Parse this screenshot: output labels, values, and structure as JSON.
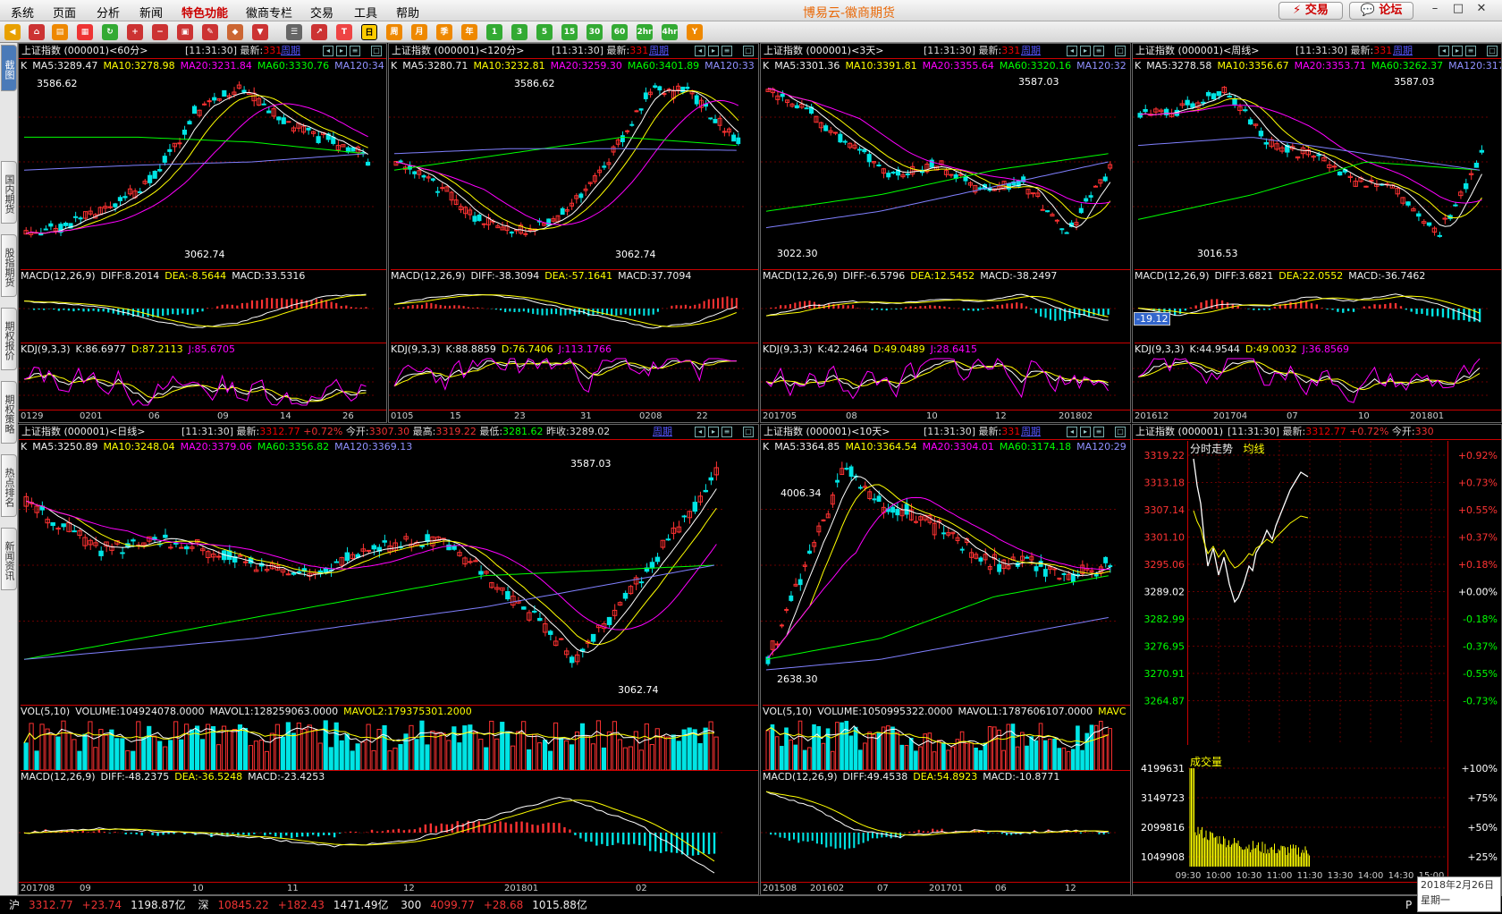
{
  "menu": [
    "系统",
    "页面",
    "分析",
    "新闻",
    "特色功能",
    "徽商专栏",
    "交易",
    "工具",
    "帮助"
  ],
  "app_title": "博易云-徽商期货",
  "buttons": {
    "trade": "交易",
    "forum": "论坛"
  },
  "toolbar_periods": [
    "周",
    "月",
    "季",
    "年",
    "1",
    "3",
    "5",
    "15",
    "30",
    "60",
    "2hr",
    "4hr",
    "Y"
  ],
  "sidebar_tabs": [
    "截图",
    "国内期货",
    "股指期货",
    "期权报价",
    "期权策略",
    "热点排名",
    "新闻资讯"
  ],
  "colors": {
    "up": "#ff3232",
    "down": "#00e5e5",
    "ma5": "#ffffff",
    "ma10": "#ffff00",
    "ma20": "#ff00ff",
    "ma60": "#00ff00",
    "ma120": "#8080ff"
  },
  "common": {
    "name": "上证指数 (000001)",
    "time": "[11:31:30]",
    "last_label": "最新:",
    "last": "331",
    "zq": "周期",
    "k": "K"
  },
  "p1": {
    "period": "<60分>",
    "ma": [
      "MA5:3289.47",
      "MA10:3278.98",
      "MA20:3231.84",
      "MA60:3330.76",
      "MA120:34"
    ],
    "hi": "3586.62",
    "lo": "3062.74",
    "macd": [
      "MACD(12,26,9)",
      "DIFF:8.2014",
      "DEA:-8.5644",
      "MACD:33.5316"
    ],
    "kdj": [
      "KDJ(9,3,3)",
      "K:86.6977",
      "D:87.2113",
      "J:85.6705"
    ],
    "x": [
      "0129",
      "0201",
      "06",
      "09",
      "14",
      "26"
    ]
  },
  "p2": {
    "period": "<120分>",
    "ma": [
      "MA5:3280.71",
      "MA10:3232.81",
      "MA20:3259.30",
      "MA60:3401.89",
      "MA120:33"
    ],
    "hi": "3586.62",
    "lo": "3062.74",
    "macd": [
      "MACD(12,26,9)",
      "DIFF:-38.3094",
      "DEA:-57.1641",
      "MACD:37.7094"
    ],
    "kdj": [
      "KDJ(9,3,3)",
      "K:88.8859",
      "D:76.7406",
      "J:113.1766"
    ],
    "x": [
      "0105",
      "15",
      "23",
      "31",
      "0208",
      "22"
    ]
  },
  "p3": {
    "period": "<3天>",
    "ma": [
      "MA5:3301.36",
      "MA10:3391.81",
      "MA20:3355.64",
      "MA60:3320.16",
      "MA120:32"
    ],
    "hi": "3587.03",
    "lo": "3022.30",
    "macd": [
      "MACD(12,26,9)",
      "DIFF:-6.5796",
      "DEA:12.5452",
      "MACD:-38.2497"
    ],
    "kdj": [
      "KDJ(9,3,3)",
      "K:42.2464",
      "D:49.0489",
      "J:28.6415"
    ],
    "x": [
      "201705",
      "08",
      "10",
      "12",
      "201802"
    ]
  },
  "p4": {
    "period": "<周线>",
    "ma": [
      "MA5:3278.58",
      "MA10:3356.67",
      "MA20:3353.71",
      "MA60:3262.37",
      "MA120:317"
    ],
    "hi": "3587.03",
    "lo": "3016.53",
    "macd": [
      "MACD(12,26,9)",
      "DIFF:3.6821",
      "DEA:22.0552",
      "MACD:-36.7462"
    ],
    "kdj": [
      "KDJ(9,3,3)",
      "K:44.9544",
      "D:49.0032",
      "J:36.8569"
    ],
    "x": [
      "201612",
      "201704",
      "07",
      "10",
      "201801"
    ],
    "cursor": "-19.12"
  },
  "p5": {
    "period": "<日线>",
    "last": "3312.77",
    "pct": "+0.72%",
    "open_l": "今开:",
    "open": "3307.30",
    "high_l": "最高:",
    "high": "3319.22",
    "low_l": "最低:",
    "low": "3281.62",
    "prev_l": "昨收:",
    "prev": "3289.02",
    "ma": [
      "MA5:3250.89",
      "MA10:3248.04",
      "MA20:3379.06",
      "MA60:3356.82",
      "MA120:3369.13"
    ],
    "hi": "3587.03",
    "lo": "3062.74",
    "vol": [
      "VOL(5,10)",
      "VOLUME:104924078.0000",
      "MAVOL1:128259063.0000",
      "MAVOL2:179375301.2000"
    ],
    "macd": [
      "MACD(12,26,9)",
      "DIFF:-48.2375",
      "DEA:-36.5248",
      "MACD:-23.4253"
    ],
    "x": [
      "201708",
      "09",
      "10",
      "11",
      "12",
      "201801",
      "02"
    ]
  },
  "p6": {
    "period": "<10天>",
    "ma": [
      "MA5:3364.85",
      "MA10:3364.54",
      "MA20:3304.01",
      "MA60:3174.18",
      "MA120:29"
    ],
    "hi": "4006.34",
    "lo": "2638.30",
    "vol": [
      "VOL(5,10)",
      "VOLUME:1050995322.0000",
      "MAVOL1:1787606107.0000",
      "MAVC"
    ],
    "macd": [
      "MACD(12,26,9)",
      "DIFF:49.4538",
      "DEA:54.8923",
      "MACD:-10.8771"
    ],
    "x": [
      "201508",
      "201602",
      "07",
      "201701",
      "06",
      "12"
    ]
  },
  "p7": {
    "last": "3312.77",
    "pct": "+0.72%",
    "open_l": "今开:",
    "open": "330",
    "title": "分时走势",
    "avg": "均线",
    "prices": [
      "3319.22",
      "3313.18",
      "3307.14",
      "3301.10",
      "3295.06",
      "3289.02",
      "3282.99",
      "3276.95",
      "3270.91",
      "3264.87"
    ],
    "pcts": [
      "+0.92%",
      "+0.73%",
      "+0.55%",
      "+0.37%",
      "+0.18%",
      "+0.00%",
      "-0.18%",
      "-0.37%",
      "-0.55%",
      "-0.73%"
    ],
    "vol_title": "成交量",
    "vols": [
      "4199631",
      "3149723",
      "2099816",
      "1049908"
    ],
    "vpcts": [
      "+100%",
      "+75%",
      "+50%",
      "+25%"
    ],
    "x": [
      "09:30",
      "10:00",
      "10:30",
      "11:00",
      "11:30",
      "13:30",
      "14:00",
      "14:30",
      "15:00"
    ]
  },
  "status": {
    "sh": "沪",
    "sh_v": "3312.77",
    "sh_c": "+23.74",
    "sh_a": "1198.87亿",
    "sz": "深",
    "sz_v": "10845.22",
    "sz_c": "+182.43",
    "sz_a": "1471.49亿",
    "c300": "300",
    "c300_v": "4099.77",
    "c300_c": "+28.68",
    "c300_a": "1015.88亿",
    "tail": "P"
  },
  "datebox": {
    "date": "2018年2月26日",
    "weekday": "星期一"
  }
}
